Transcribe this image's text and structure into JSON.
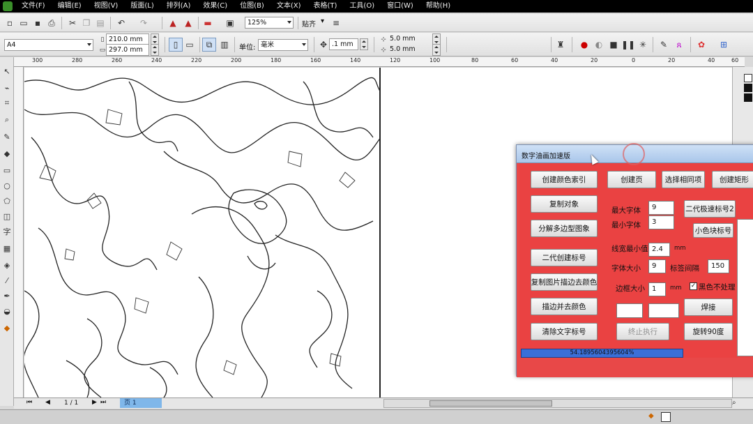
{
  "menu": [
    "文件(F)",
    "编辑(E)",
    "视图(V)",
    "版面(L)",
    "排列(A)",
    "效果(C)",
    "位图(B)",
    "文本(X)",
    "表格(T)",
    "工具(O)",
    "窗口(W)",
    "帮助(H)"
  ],
  "toolbar": {
    "zoom_value": "125%",
    "snap_label": "贴齐"
  },
  "property_bar": {
    "page_size": "A4",
    "width": "210.0 mm",
    "height": "297.0 mm",
    "units_label": "单位:",
    "units_value": "毫米",
    "nudge": ".1 mm",
    "dup_x": "5.0 mm",
    "dup_y": "5.0 mm"
  },
  "ruler_top_ticks": [
    "300",
    "280",
    "260",
    "240",
    "220",
    "200",
    "180",
    "160",
    "140",
    "120",
    "100",
    "80",
    "60",
    "40",
    "20",
    "0",
    "20",
    "40",
    "60"
  ],
  "pagebar": {
    "page_count": "1 / 1",
    "page_tab": "页 1"
  },
  "dialog": {
    "title": "数字油画加速版",
    "buttons": {
      "create_color_index": "创建颜色索引",
      "create_page": "创建页",
      "select_same": "选择相同项",
      "create_rect": "创建矩形",
      "copy_object": "复制对象",
      "gen2_fast_label": "二代极速标号2",
      "split_polygon": "分解多边型图象",
      "small_color_label": "小色块标号",
      "gen2_create_label": "二代创建标号",
      "copy_trace_color": "复制图片描边去颜色",
      "trace_remove_color": "描边并去颜色",
      "weld": "焊接",
      "clear_text_labels": "清除文字标号",
      "stop_exec": "终止执行",
      "rotate_90": "旋转90度"
    },
    "fields": {
      "max_font_label": "最大字体",
      "max_font": "9",
      "min_font_label": "最小字体",
      "min_font": "3",
      "min_line_label": "线宽最小值",
      "min_line": "2.4",
      "min_line_unit": "mm",
      "font_size_label": "字体大小",
      "font_size": "9",
      "label_gap_label": "标签间隔",
      "label_gap": "150",
      "border_label": "边框大小",
      "border": "1",
      "border_unit": "mm",
      "black_skip_label": "黑色不处理",
      "blank1": "",
      "blank2": ""
    },
    "progress_text": "54.1895604395604%",
    "progress_value": 0.54
  }
}
